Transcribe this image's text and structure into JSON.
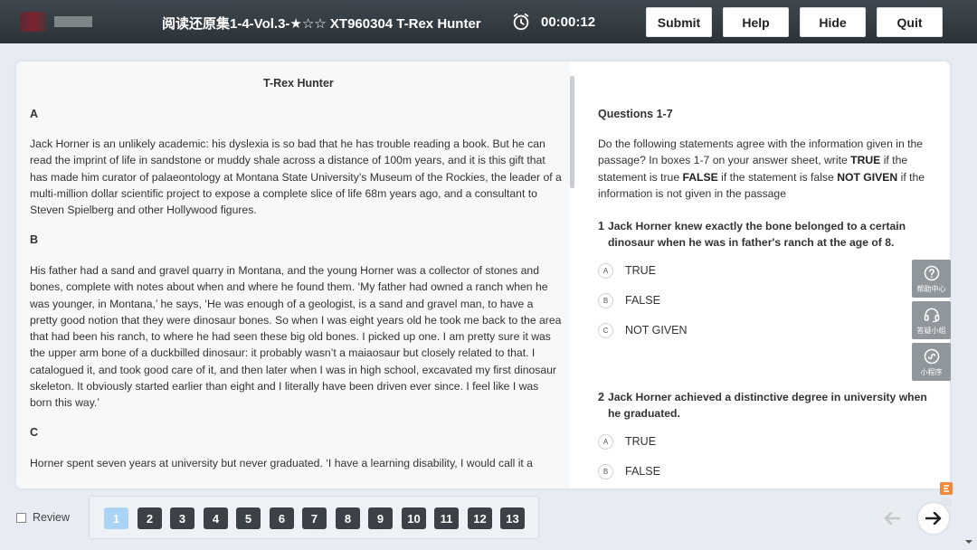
{
  "header": {
    "exam_title": "阅读还原集1-4-Vol.3-★☆☆ XT960304 T-Rex Hunter",
    "timer": "00:00:12",
    "buttons": {
      "submit": "Submit",
      "help": "Help",
      "hide": "Hide",
      "quit": "Quit"
    }
  },
  "passage": {
    "title": "T-Rex Hunter",
    "paragraphs": [
      {
        "letter": "A",
        "text": "Jack Horner is an unlikely academic: his dyslexia is so bad that he has trouble reading a book. But he can read the imprint of life in sandstone or muddy shale across a distance of 100m years, and it is this gift that has made him curator of palaeontology at Montana State University’s Museum of the Rockies, the leader of a multi-million dollar scientific project to expose a complete slice of life 68m years ago, and a consultant to Steven Spielberg and other Hollywood figures."
      },
      {
        "letter": "B",
        "text": "His father had a sand and gravel quarry in Montana, and the young Horner was a collector of stones and bones, complete with notes about when and where he found them. ‘My father had owned a ranch when he was younger, in Montana,’ he says, ‘He was enough of a geologist, is a sand and gravel man, to have a pretty good notion that they were dinosaur bones. So when I was eight years old he took me back to the area that had been his ranch, to where he had seen these big old bones. I picked up one. I am pretty sure it was the upper arm bone of a duckbilled dinosaur: it probably wasn’t a maiaosaur but closely related to that. I catalogued it, and took good care of it, and then later when I was in high school, excavated my first dinosaur skeleton. It obviously started earlier than eight and I literally have been driven ever since. I feel like I was born this way.’"
      },
      {
        "letter": "C",
        "text": "Horner spent seven years at university but never graduated. ‘I have a learning disability, I would call it a"
      }
    ]
  },
  "questions": {
    "heading": "Questions 1-7",
    "instruction_parts": [
      "Do the following statements agree with the information given in the passage? In boxes 1-7 on your answer sheet, write ",
      "TRUE",
      " if the statement is true ",
      "FALSE",
      " if the statement is false ",
      "NOT GIVEN",
      " if the information is not given in the passage"
    ],
    "items": [
      {
        "number": "1",
        "text": "Jack Horner knew exactly the bone belonged to a certain dinosaur when he was in father's ranch at the age of 8.",
        "options": [
          {
            "letter": "A",
            "text": "TRUE"
          },
          {
            "letter": "B",
            "text": "FALSE"
          },
          {
            "letter": "C",
            "text": "NOT GIVEN"
          }
        ]
      },
      {
        "number": "2",
        "text": "Jack Horner achieved a distinctive degree in university when he graduated.",
        "options": [
          {
            "letter": "A",
            "text": "TRUE"
          },
          {
            "letter": "B",
            "text": "FALSE"
          }
        ]
      }
    ]
  },
  "side_widgets": [
    {
      "label": "帮助中心",
      "icon": "question-circle-icon"
    },
    {
      "label": "答疑小组",
      "icon": "headset-icon"
    },
    {
      "label": "小程序",
      "icon": "mini-program-icon"
    }
  ],
  "footer": {
    "review_label": "Review",
    "pages": [
      "1",
      "2",
      "3",
      "4",
      "5",
      "6",
      "7",
      "8",
      "9",
      "10",
      "11",
      "12",
      "13"
    ],
    "active_page": "1"
  },
  "colors": {
    "header_bg": "#2f363c",
    "page_active": "#a9d4f5",
    "page_default": "#3b4146",
    "widget_bg": "#8f969c"
  }
}
